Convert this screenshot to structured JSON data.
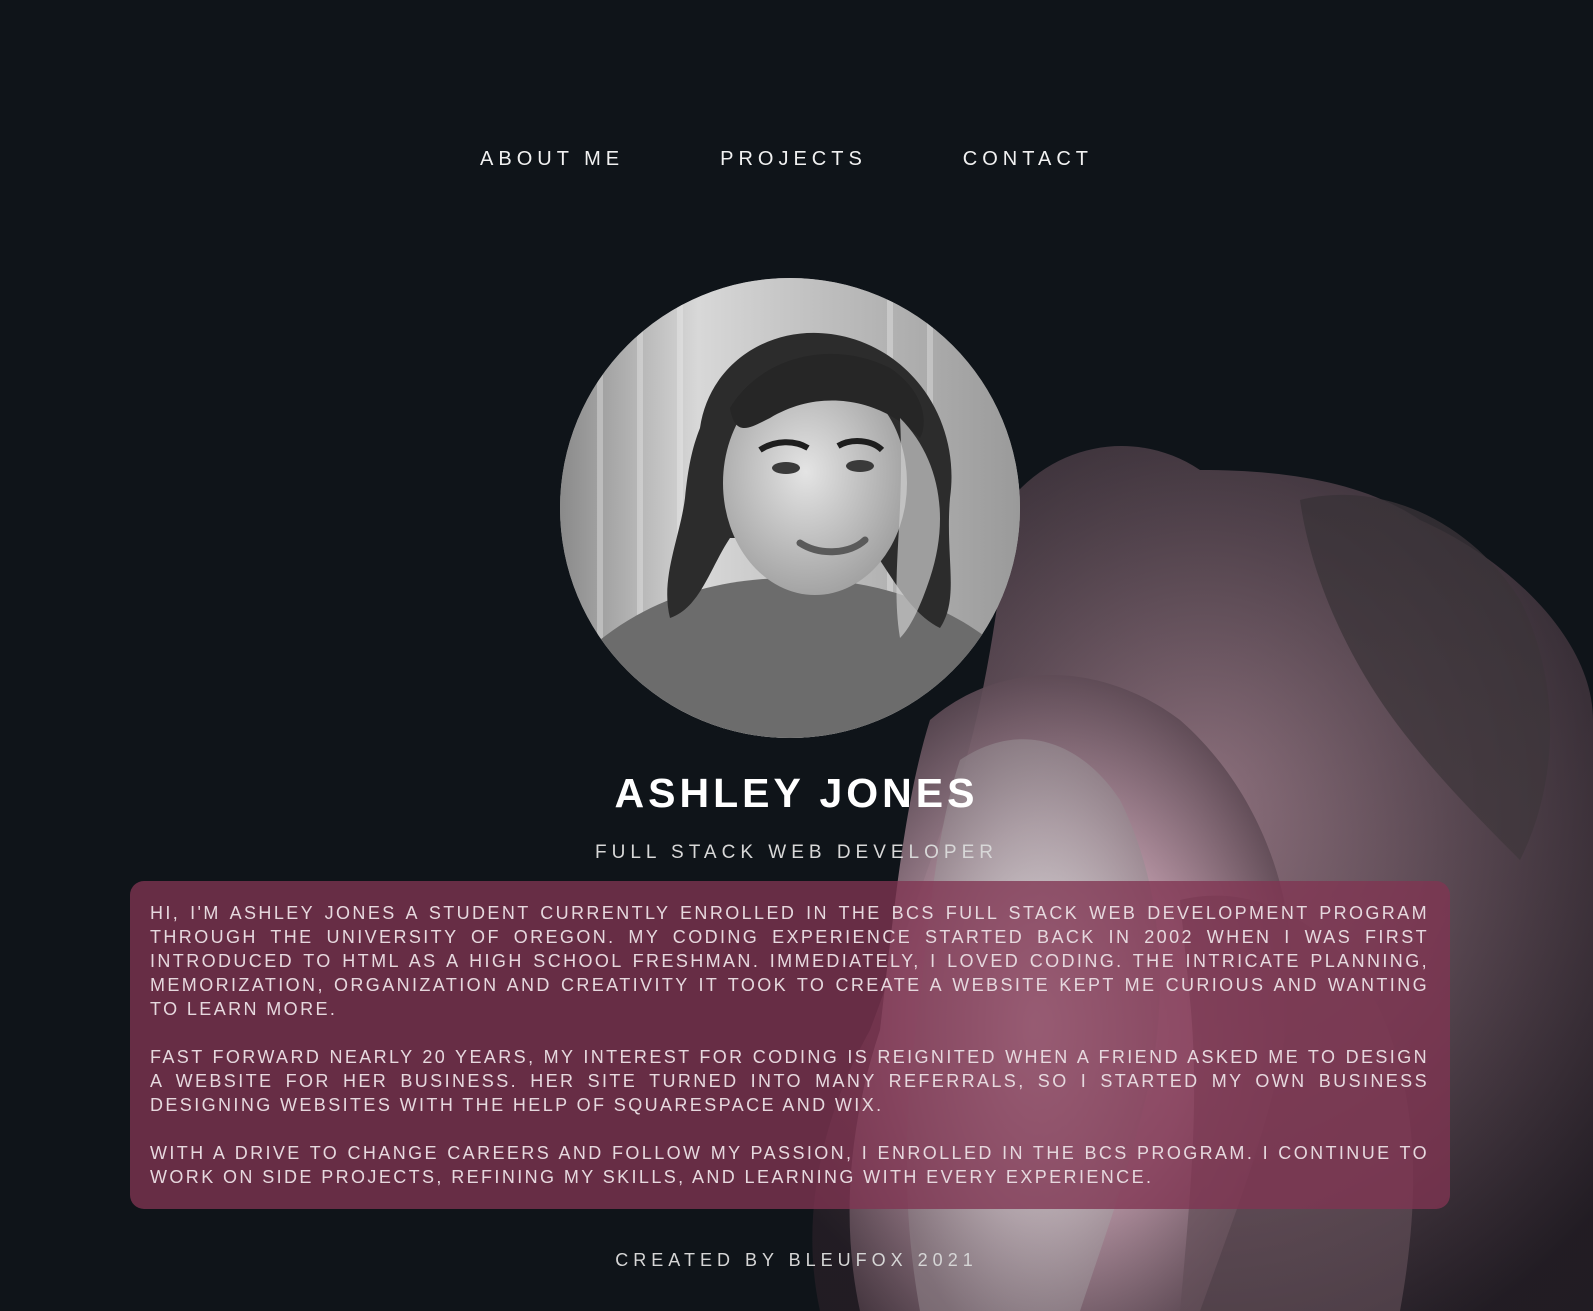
{
  "nav": {
    "items": [
      {
        "label": "ABOUT ME"
      },
      {
        "label": "PROJECTS"
      },
      {
        "label": "CONTACT"
      }
    ]
  },
  "profile": {
    "name": "ASHLEY JONES",
    "title": "FULL STACK WEB DEVELOPER"
  },
  "bio": {
    "paragraphs": [
      "HI, I'M ASHLEY JONES A STUDENT CURRENTLY ENROLLED IN THE BCS FULL STACK WEB DEVELOPMENT PROGRAM THROUGH THE UNIVERSITY OF OREGON. MY CODING EXPERIENCE STARTED BACK IN 2002 WHEN I WAS FIRST INTRODUCED TO HTML AS A HIGH SCHOOL FRESHMAN. IMMEDIATELY, I LOVED CODING. THE INTRICATE PLANNING, MEMORIZATION, ORGANIZATION AND CREATIVITY IT TOOK TO CREATE A WEBSITE KEPT ME CURIOUS AND WANTING TO LEARN MORE.",
      "FAST FORWARD NEARLY 20 YEARS, MY INTEREST FOR CODING IS REIGNITED WHEN A FRIEND ASKED ME TO DESIGN A WEBSITE FOR HER BUSINESS. HER SITE TURNED INTO MANY REFERRALS, SO I STARTED MY OWN BUSINESS DESIGNING WEBSITES WITH THE HELP OF SQUARESPACE AND WIX.",
      "WITH A DRIVE TO CHANGE CAREERS AND FOLLOW MY PASSION, I ENROLLED IN THE BCS PROGRAM. I CONTINUE TO WORK ON SIDE PROJECTS, REFINING MY SKILLS, AND LEARNING WITH EVERY EXPERIENCE."
    ]
  },
  "footer": {
    "text": "CREATED BY BLEUFOX 2021"
  },
  "colors": {
    "background": "#0f1419",
    "bio_panel": "#803452",
    "text": "#ffffff"
  }
}
